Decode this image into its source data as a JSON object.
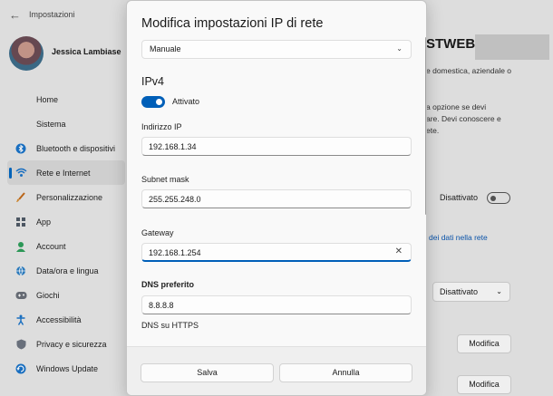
{
  "window": {
    "app_title": "Impostazioni",
    "user_name": "Jessica Lambiase"
  },
  "sidebar": {
    "items": [
      {
        "label": "Home",
        "icon": "",
        "active": false
      },
      {
        "label": "Sistema",
        "icon": "",
        "active": false
      },
      {
        "label": "Bluetooth e dispositivi",
        "icon": "bluetooth-icon",
        "active": false
      },
      {
        "label": "Rete e Internet",
        "icon": "network-icon",
        "active": true
      },
      {
        "label": "Personalizzazione",
        "icon": "brush-icon",
        "active": false
      },
      {
        "label": "App",
        "icon": "apps-icon",
        "active": false
      },
      {
        "label": "Account",
        "icon": "account-icon",
        "active": false
      },
      {
        "label": "Data/ora e lingua",
        "icon": "globe-icon",
        "active": false
      },
      {
        "label": "Giochi",
        "icon": "gamepad-icon",
        "active": false
      },
      {
        "label": "Accessibilità",
        "icon": "accessibility-icon",
        "active": false
      },
      {
        "label": "Privacy e sicurezza",
        "icon": "shield-icon",
        "active": false
      },
      {
        "label": "Windows Update",
        "icon": "update-icon",
        "active": false
      }
    ]
  },
  "right_pane": {
    "heading": "STWEB",
    "text_line1": "e domestica, aziendale o",
    "text_line2": "a opzione se devi",
    "text_line3": "are. Devi conoscere e",
    "text_line4": "ete.",
    "toggle_label": "Disattivato",
    "link": "dei dati nella rete",
    "select_value": "Disattivato",
    "button1": "Modifica",
    "button2": "Modifica"
  },
  "dialog": {
    "title": "Modifica impostazioni IP di rete",
    "mode_value": "Manuale",
    "ipv4_heading": "IPv4",
    "ipv4_toggle_label": "Attivato",
    "ip_label": "Indirizzo IP",
    "ip_value": "192.168.1.34",
    "subnet_label": "Subnet mask",
    "subnet_value": "255.255.248.0",
    "gateway_label": "Gateway",
    "gateway_value": "192.168.1.254",
    "dns_label": "DNS preferito",
    "dns_value": "8.8.8.8",
    "dns_https_label": "DNS su HTTPS",
    "save_label": "Salva",
    "cancel_label": "Annulla"
  },
  "colors": {
    "accent": "#005fb8",
    "link": "#0b57b0"
  }
}
